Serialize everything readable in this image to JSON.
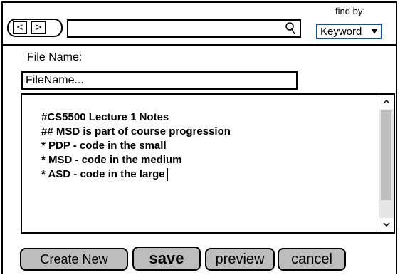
{
  "nav": {
    "back_label": "<",
    "forward_label": ">"
  },
  "search": {
    "value": "",
    "placeholder": ""
  },
  "find_by": {
    "label": "find by:",
    "selected": "Keyword"
  },
  "file_name": {
    "label": "File Name:",
    "placeholder": "FileName..."
  },
  "editor": {
    "lines": [
      "#CS5500 Lecture 1 Notes",
      "## MSD is part of course progression",
      "* PDP - code in the small",
      "* MSD - code in the medium",
      "* ASD - code in the large"
    ]
  },
  "buttons": {
    "create_new": "Create New",
    "save": "save",
    "preview": "preview",
    "cancel": "cancel"
  },
  "colors": {
    "select_border": "#1c4e8c",
    "button_bg": "#bdbdbd",
    "scroll_track": "#e6e6e6"
  }
}
